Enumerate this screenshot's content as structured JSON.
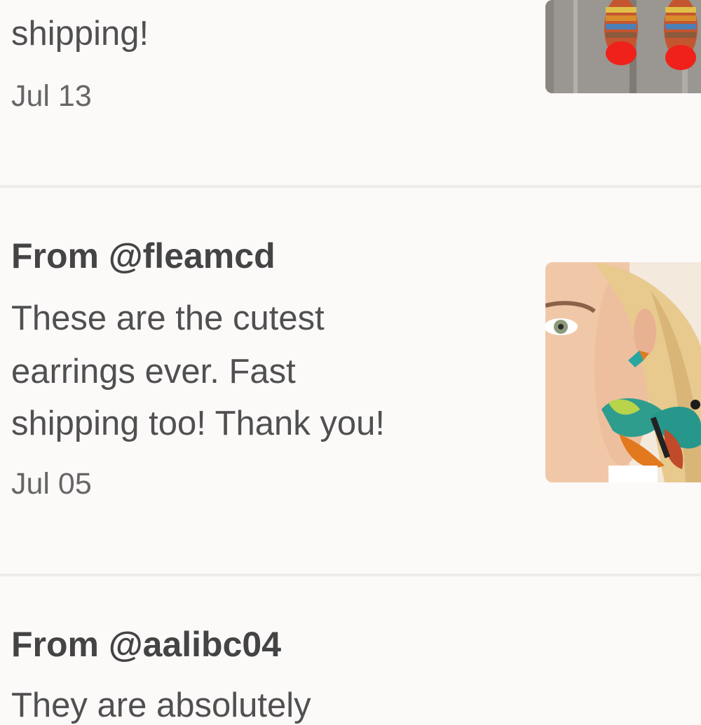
{
  "reviews": [
    {
      "body_lines": [
        "shipping!"
      ],
      "date": "Jul 13",
      "image": "feather-earrings-photo"
    },
    {
      "author": "From @fleamcd",
      "body_lines": [
        "These are the cutest",
        "earrings ever. Fast",
        "shipping too! Thank you!"
      ],
      "date": "Jul 05",
      "image": "butterfly-earrings-model-photo"
    },
    {
      "author": "From @aalibc04",
      "body_lines": [
        "They are absolutely"
      ]
    }
  ]
}
